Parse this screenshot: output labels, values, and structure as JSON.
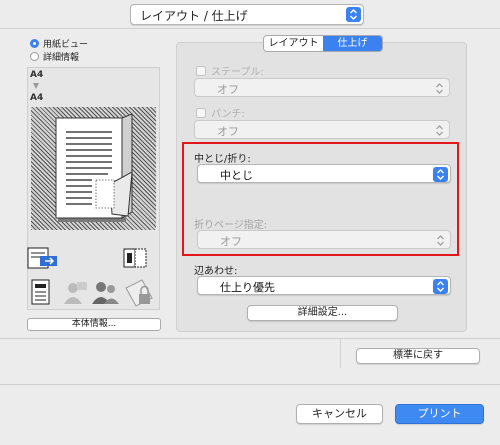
{
  "top_popup": {
    "value": "レイアウト / 仕上げ"
  },
  "view_options": [
    {
      "label": "用紙ビュー",
      "selected": true
    },
    {
      "label": "詳細情報",
      "selected": false
    }
  ],
  "preview": {
    "paper_from": "A4",
    "paper_to": "A4"
  },
  "machine_info_button": "本体情報...",
  "tabs": [
    {
      "label": "レイアウト",
      "active": false
    },
    {
      "label": "仕上げ",
      "active": true
    }
  ],
  "staple": {
    "label": "ステープル:",
    "value": "オフ",
    "enabled": false
  },
  "punch": {
    "label": "パンチ:",
    "value": "オフ",
    "enabled": false
  },
  "fold": {
    "label": "中とじ/折り:",
    "value": "中とじ"
  },
  "fold_page": {
    "label": "折りページ指定:",
    "value": "オフ",
    "enabled": false
  },
  "edge_align": {
    "label": "辺あわせ:",
    "value": "仕上り優先"
  },
  "details_button": "詳細設定...",
  "reset_button": "標準に戻す",
  "cancel_button": "キャンセル",
  "print_button": "プリント",
  "colors": {
    "accent": "#3b82f0",
    "highlight": "#e3161b"
  }
}
